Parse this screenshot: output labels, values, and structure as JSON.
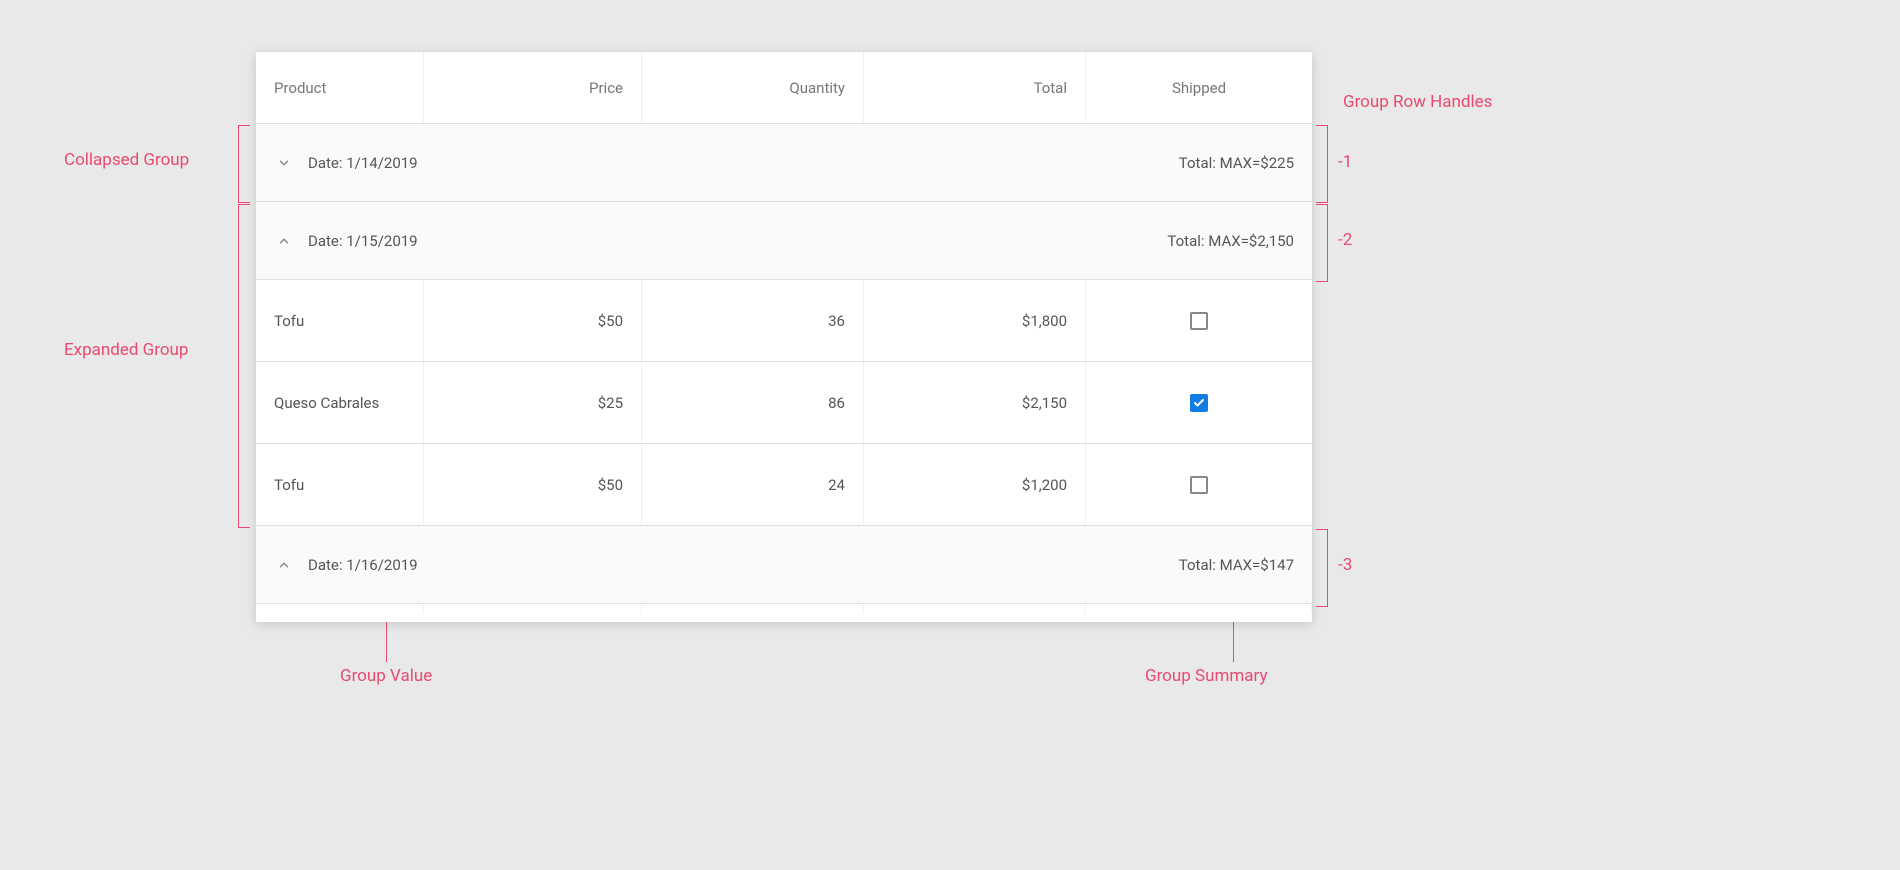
{
  "columns": {
    "product": "Product",
    "price": "Price",
    "quantity": "Quantity",
    "total": "Total",
    "shipped": "Shipped"
  },
  "groups": [
    {
      "expanded": false,
      "label": "Date: 1/14/2019",
      "summary": "Total: MAX=$225",
      "rows": []
    },
    {
      "expanded": true,
      "label": "Date: 1/15/2019",
      "summary": "Total: MAX=$2,150",
      "rows": [
        {
          "product": "Tofu",
          "price": "$50",
          "quantity": "36",
          "total": "$1,800",
          "shipped": false
        },
        {
          "product": "Queso Cabrales",
          "price": "$25",
          "quantity": "86",
          "total": "$2,150",
          "shipped": true
        },
        {
          "product": "Tofu",
          "price": "$50",
          "quantity": "24",
          "total": "$1,200",
          "shipped": false
        }
      ]
    },
    {
      "expanded": true,
      "label_prefix": "Date: ",
      "label_value": "1/16/2019",
      "summary": "Total: MAX=$147",
      "rows": []
    }
  ],
  "annotations": {
    "collapsed_group": "Collapsed Group",
    "expanded_group": "Expanded Group",
    "group_row_handles": "Group Row Handles",
    "handle_1": "-1",
    "handle_2": "-2",
    "handle_3": "-3",
    "group_value": "Group Value",
    "group_summary": "Group Summary"
  }
}
